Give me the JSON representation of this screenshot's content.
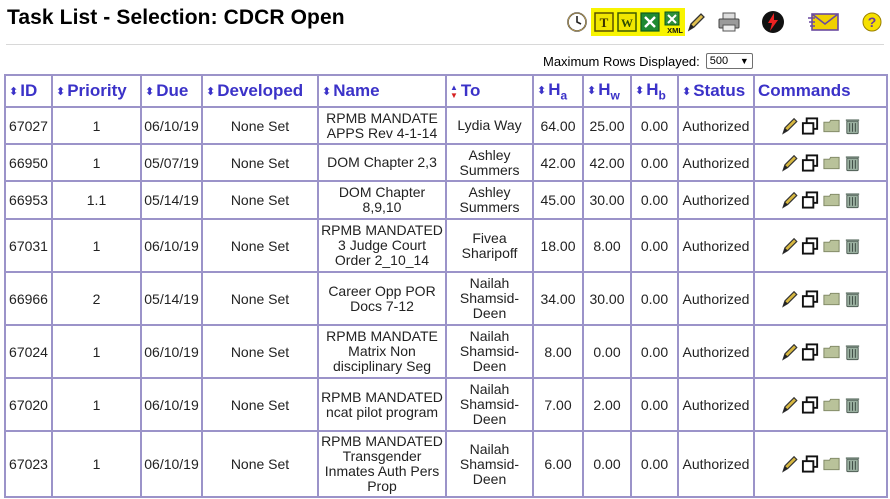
{
  "page": {
    "title": "Task List - Selection: CDCR Open"
  },
  "toolbar": {
    "icons": [
      "clock-icon",
      "text-export-icon",
      "word-export-icon",
      "excel-export-icon",
      "xml-export-icon",
      "pencil-icon",
      "printer-icon",
      "emergency-icon",
      "email-icon",
      "help-icon"
    ],
    "text_letter": "T",
    "word_letter": "W",
    "xml_text": "XML",
    "help_text": "?",
    "highlight_color": "#f8f400"
  },
  "controls": {
    "max_rows_label": "Maximum Rows Displayed:",
    "max_rows_value": "500"
  },
  "table": {
    "columns": {
      "id": "ID",
      "priority": "Priority",
      "due": "Due",
      "developed": "Developed",
      "name": "Name",
      "to": "To",
      "ha": "H",
      "ha_sub": "a",
      "hw": "H",
      "hw_sub": "w",
      "hb": "H",
      "hb_sub": "b",
      "status": "Status",
      "commands": "Commands"
    },
    "rows": [
      {
        "id": "67027",
        "priority": "1",
        "due": "06/10/19",
        "developed": "None Set",
        "name": [
          "RPMB MANDATE",
          "APPS Rev 4-1-14"
        ],
        "to": [
          "Lydia Way"
        ],
        "ha": "64.00",
        "hw": "25.00",
        "hb": "0.00",
        "status": "Authorized",
        "late": false,
        "height": 37
      },
      {
        "id": "66950",
        "priority": "1",
        "due": "05/07/19",
        "developed": "None Set",
        "name": [
          "DOM Chapter 2,3"
        ],
        "to": [
          "Ashley",
          "Summers"
        ],
        "ha": "42.00",
        "hw": "42.00",
        "hb": "0.00",
        "status": "Authorized",
        "late": true,
        "height": 37
      },
      {
        "id": "66953",
        "priority": "1.1",
        "due": "05/14/19",
        "developed": "None Set",
        "name": [
          "DOM Chapter",
          "8,9,10"
        ],
        "to": [
          "Ashley",
          "Summers"
        ],
        "ha": "45.00",
        "hw": "30.00",
        "hb": "0.00",
        "status": "Authorized",
        "late": true,
        "height": 38
      },
      {
        "id": "67031",
        "priority": "1",
        "due": "06/10/19",
        "developed": "None Set",
        "name": [
          "RPMB MANDATED",
          "3 Judge Court",
          "Order 2_10_14"
        ],
        "to": [
          "Fivea",
          "Sharipoff"
        ],
        "ha": "18.00",
        "hw": "8.00",
        "hb": "0.00",
        "status": "Authorized",
        "late": false,
        "height": 53
      },
      {
        "id": "66966",
        "priority": "2",
        "due": "05/14/19",
        "developed": "None Set",
        "name": [
          "Career Opp POR",
          "Docs 7-12"
        ],
        "to": [
          "Nailah",
          "Shamsid-",
          "Deen"
        ],
        "ha": "34.00",
        "hw": "30.00",
        "hb": "0.00",
        "status": "Authorized",
        "late": true,
        "height": 53
      },
      {
        "id": "67024",
        "priority": "1",
        "due": "06/10/19",
        "developed": "None Set",
        "name": [
          "RPMB MANDATE",
          "Matrix Non",
          "disciplinary Seg"
        ],
        "to": [
          "Nailah",
          "Shamsid-",
          "Deen"
        ],
        "ha": "8.00",
        "hw": "0.00",
        "hb": "0.00",
        "status": "Authorized",
        "late": false,
        "height": 53
      },
      {
        "id": "67020",
        "priority": "1",
        "due": "06/10/19",
        "developed": "None Set",
        "name": [
          "RPMB MANDATED",
          "ncat pilot program"
        ],
        "to": [
          "Nailah",
          "Shamsid-",
          "Deen"
        ],
        "ha": "7.00",
        "hw": "2.00",
        "hb": "0.00",
        "status": "Authorized",
        "late": false,
        "height": 53
      },
      {
        "id": "67023",
        "priority": "1",
        "due": "06/10/19",
        "developed": "None Set",
        "name": [
          "RPMB MANDATED",
          "Transgender",
          "Inmates Auth Pers",
          "Prop"
        ],
        "to": [
          "Nailah",
          "Shamsid-",
          "Deen"
        ],
        "ha": "6.00",
        "hw": "0.00",
        "hb": "0.00",
        "status": "Authorized",
        "late": false,
        "height": 66
      }
    ]
  }
}
